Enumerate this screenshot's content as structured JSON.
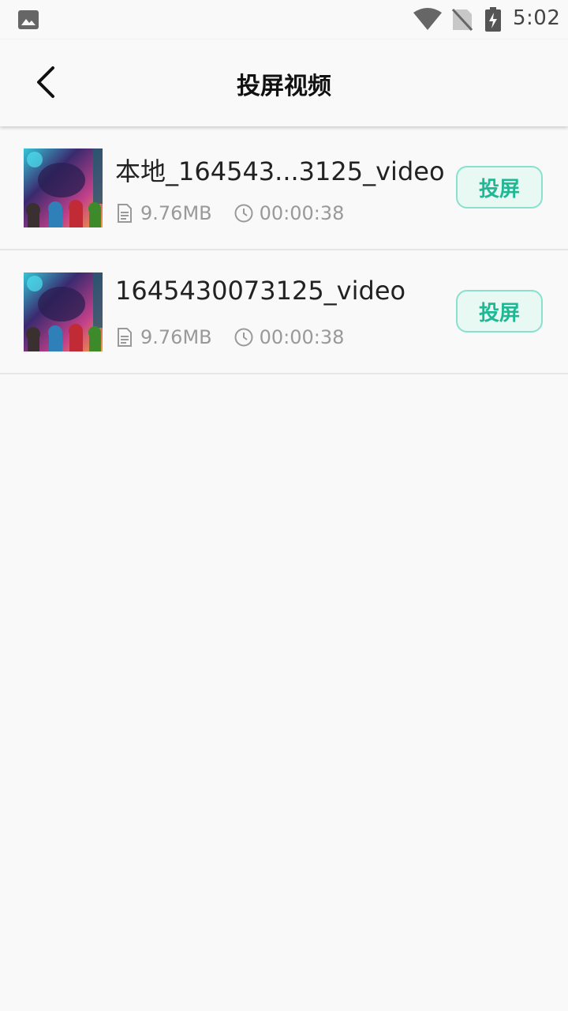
{
  "status_bar": {
    "time": "5:02",
    "icons": [
      "image-notification-icon",
      "wifi-icon",
      "no-sim-icon",
      "battery-charging-icon"
    ]
  },
  "header": {
    "back_icon": "chevron-left-icon",
    "title": "投屏视频"
  },
  "videos": [
    {
      "title": "本地_164543...3125_video",
      "size": "9.76MB",
      "duration": "00:00:38",
      "cast_label": "投屏"
    },
    {
      "title": "1645430073125_video",
      "size": "9.76MB",
      "duration": "00:00:38",
      "cast_label": "投屏"
    }
  ],
  "colors": {
    "accent": "#1fb895",
    "button_border": "#8be0cc",
    "button_bg": "#e8f8f3",
    "meta_text": "#999999",
    "background": "#f9f9f9"
  }
}
